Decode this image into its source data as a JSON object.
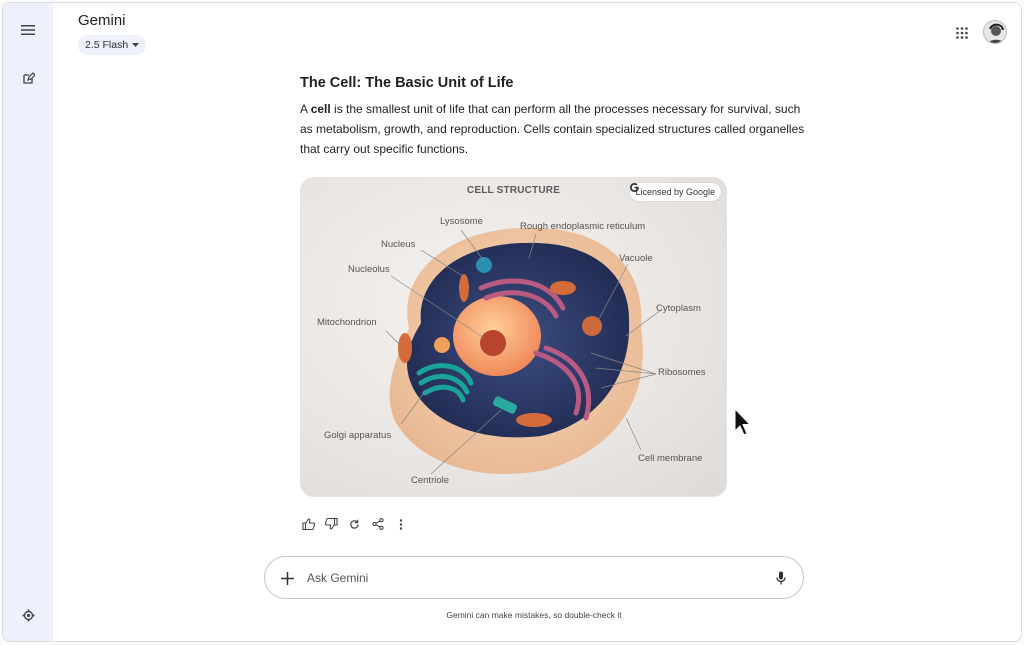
{
  "header": {
    "app_title": "Gemini",
    "model_label": "2.5 Flash"
  },
  "response": {
    "title": "The Cell: The Basic Unit of Life",
    "para_prefix": "A ",
    "para_bold": "cell",
    "para_rest": " is the smallest unit of life that can perform all the processes necessary for survival, such as metabolism, growth, and reproduction. Cells contain specialized structures called organelles that carry out specific functions."
  },
  "figure": {
    "heading": "CELL STRUCTURE",
    "license_label": "Licensed by Google",
    "labels": {
      "lysosome": "Lysosome",
      "rough_er": "Rough endoplasmic reticulum",
      "nucleus": "Nucleus",
      "vacuole": "Vacuole",
      "nucleolus": "Nucleolus",
      "cytoplasm": "Cytoplasm",
      "mitochondrion": "Mitochondrion",
      "ribosomes": "Ribosomes",
      "golgi": "Golgi apparatus",
      "cell_membrane": "Cell membrane",
      "centriole": "Centriole"
    }
  },
  "prompt": {
    "placeholder": "Ask Gemini"
  },
  "footer": {
    "disclaimer": "Gemini can make mistakes, so double-check it"
  },
  "icons": {
    "menu": "menu-icon",
    "new_chat": "edit-icon",
    "settings": "gear-icon",
    "apps": "apps-grid-icon",
    "avatar": "avatar",
    "thumbs_up": "thumbs-up-icon",
    "thumbs_down": "thumbs-down-icon",
    "regenerate": "refresh-icon",
    "share": "share-icon",
    "more": "more-vert-icon",
    "add": "plus-icon",
    "mic": "mic-icon"
  },
  "colors": {
    "rail_bg": "#eef1fb",
    "pill_bg": "#eef1fb",
    "text": "#1f1f1f"
  }
}
